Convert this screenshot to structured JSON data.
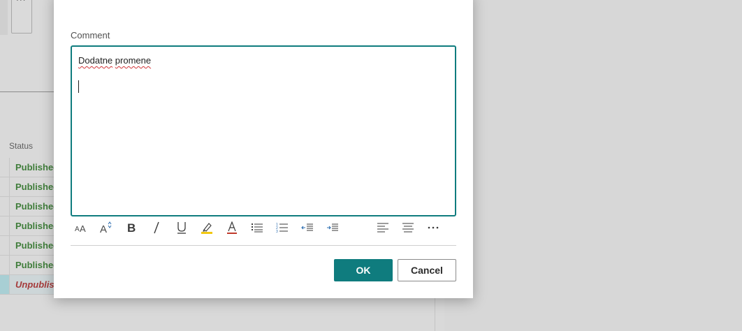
{
  "background": {
    "status_header": "Status",
    "rows": [
      {
        "status": "Published",
        "kind": "pub"
      },
      {
        "status": "Published",
        "kind": "pub"
      },
      {
        "status": "Published",
        "kind": "pub"
      },
      {
        "status": "Published",
        "kind": "pub"
      },
      {
        "status": "Published",
        "kind": "pub"
      },
      {
        "status": "Published",
        "kind": "pub"
      },
      {
        "status": "Unpublished",
        "kind": "unpub"
      }
    ],
    "more_label": "..."
  },
  "dialog": {
    "comment_label": "Comment",
    "comment_text_word1": "Dodatne",
    "comment_text_word2": "promene",
    "ok_label": "OK",
    "cancel_label": "Cancel",
    "accent_color": "#0f7c7e"
  },
  "toolbar": {
    "items": [
      {
        "name": "font-family-icon",
        "glyph": "AA"
      },
      {
        "name": "font-size-icon",
        "glyph": "A"
      },
      {
        "name": "bold-icon",
        "glyph": "B"
      },
      {
        "name": "italic-icon",
        "glyph": "/"
      },
      {
        "name": "underline-icon",
        "glyph": "U"
      },
      {
        "name": "highlight-icon",
        "glyph": ""
      },
      {
        "name": "font-color-icon",
        "glyph": "A"
      },
      {
        "name": "bulleted-list-icon",
        "glyph": ""
      },
      {
        "name": "numbered-list-icon",
        "glyph": ""
      },
      {
        "name": "decrease-indent-icon",
        "glyph": ""
      },
      {
        "name": "increase-indent-icon",
        "glyph": ""
      },
      {
        "name": "quote-icon",
        "glyph": "„"
      },
      {
        "name": "align-left-icon",
        "glyph": ""
      },
      {
        "name": "align-center-icon",
        "glyph": ""
      },
      {
        "name": "more-options-icon",
        "glyph": "···"
      }
    ]
  }
}
